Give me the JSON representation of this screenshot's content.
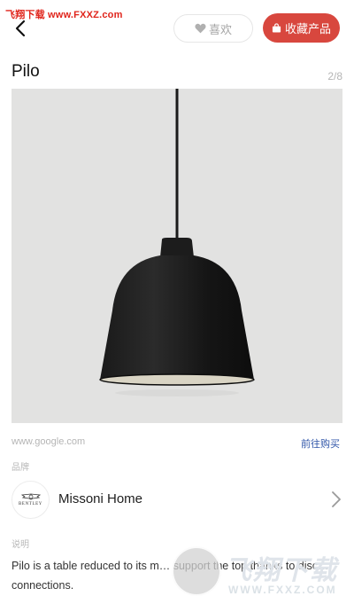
{
  "watermark_top": "飞翔下载 www.FXXZ.com",
  "header": {
    "like_label": "喜欢",
    "collect_label": "收藏产品"
  },
  "product": {
    "title": "Pilo",
    "pager": "2/8",
    "source": "www.google.com",
    "buy_label": "前往购买"
  },
  "brand": {
    "section_label": "品牌",
    "logo_text": "BENTLEY",
    "name": "Missoni Home"
  },
  "description": {
    "section_label": "说明",
    "text": "Pilo is a table reduced to its m… support the top thanks to disc… connections."
  },
  "watermark_logo": {
    "title": "飞翔下载",
    "url": "WWW.FXXZ.COM"
  },
  "colors": {
    "accent": "#d8473e",
    "link": "#2f55a8",
    "photo_bg": "#e2e2e1"
  }
}
